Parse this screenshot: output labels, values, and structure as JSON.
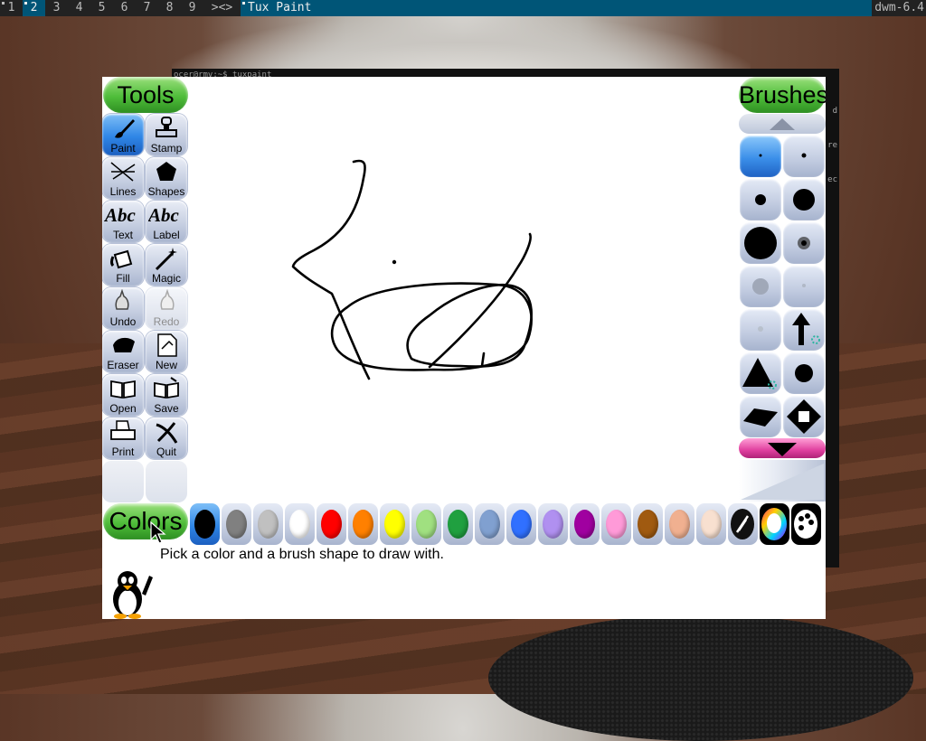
{
  "bar": {
    "tags": [
      "1",
      "2",
      "3",
      "4",
      "5",
      "6",
      "7",
      "8",
      "9"
    ],
    "selected_tag": "2",
    "layout": "><>",
    "window_title": "Tux Paint",
    "status": "dwm-6.4"
  },
  "terminal": {
    "prompt": "ocer@rmv:~$ tuxpaint",
    "edge_chars": [
      "d",
      "re",
      "ec"
    ]
  },
  "tools": {
    "header": "Tools",
    "items": [
      {
        "label": "Paint",
        "icon": "paintbrush-icon",
        "selected": true
      },
      {
        "label": "Stamp",
        "icon": "stamp-icon"
      },
      {
        "label": "Lines",
        "icon": "lines-icon"
      },
      {
        "label": "Shapes",
        "icon": "pentagon-icon"
      },
      {
        "label": "Text",
        "icon": "text-abc-icon"
      },
      {
        "label": "Label",
        "icon": "label-abc-icon"
      },
      {
        "label": "Fill",
        "icon": "paint-bucket-icon"
      },
      {
        "label": "Magic",
        "icon": "magic-wand-icon"
      },
      {
        "label": "Undo",
        "icon": "undo-hand-icon"
      },
      {
        "label": "Redo",
        "icon": "redo-hand-icon",
        "disabled": true
      },
      {
        "label": "Eraser",
        "icon": "eraser-icon"
      },
      {
        "label": "New",
        "icon": "new-page-icon"
      },
      {
        "label": "Open",
        "icon": "open-book-icon"
      },
      {
        "label": "Save",
        "icon": "save-book-icon"
      },
      {
        "label": "Print",
        "icon": "printer-icon"
      },
      {
        "label": "Quit",
        "icon": "quit-x-icon"
      }
    ],
    "text_glyph": "Abc"
  },
  "brushes": {
    "header": "Brushes",
    "scroll_up": "scroll-up-arrow-icon",
    "scroll_down": "scroll-down-arrow-icon",
    "items": [
      "brush-tiny-dot-icon",
      "brush-small-dot-icon",
      "brush-medium-dot-icon",
      "brush-large-dot-icon",
      "brush-xlarge-dot-icon",
      "brush-fuzzy-dot-icon",
      "brush-soft-large-icon",
      "brush-soft-small-icon",
      "brush-soft-medium-icon",
      "brush-arrow-icon",
      "brush-triangle-icon",
      "brush-round-icon",
      "brush-diamond-flat-icon",
      "brush-diamond-square-icon"
    ]
  },
  "colors": {
    "header": "Colors",
    "swatches": [
      "#000000",
      "#808080",
      "#c0c0c0",
      "#ffffff",
      "#ff0000",
      "#ff8000",
      "#ffff00",
      "#a0e080",
      "#20a040",
      "#80a0d0",
      "#3070ff",
      "#b090f0",
      "#a000a0",
      "#ff9ad8",
      "#a05a10",
      "#f0b090",
      "#f8e0d0"
    ],
    "extras": [
      "color-picker-icon",
      "rainbow-palette-icon",
      "palette-icon"
    ]
  },
  "tip": "Pick a color and a brush shape to draw with.",
  "mascot": "tux-penguin-icon"
}
